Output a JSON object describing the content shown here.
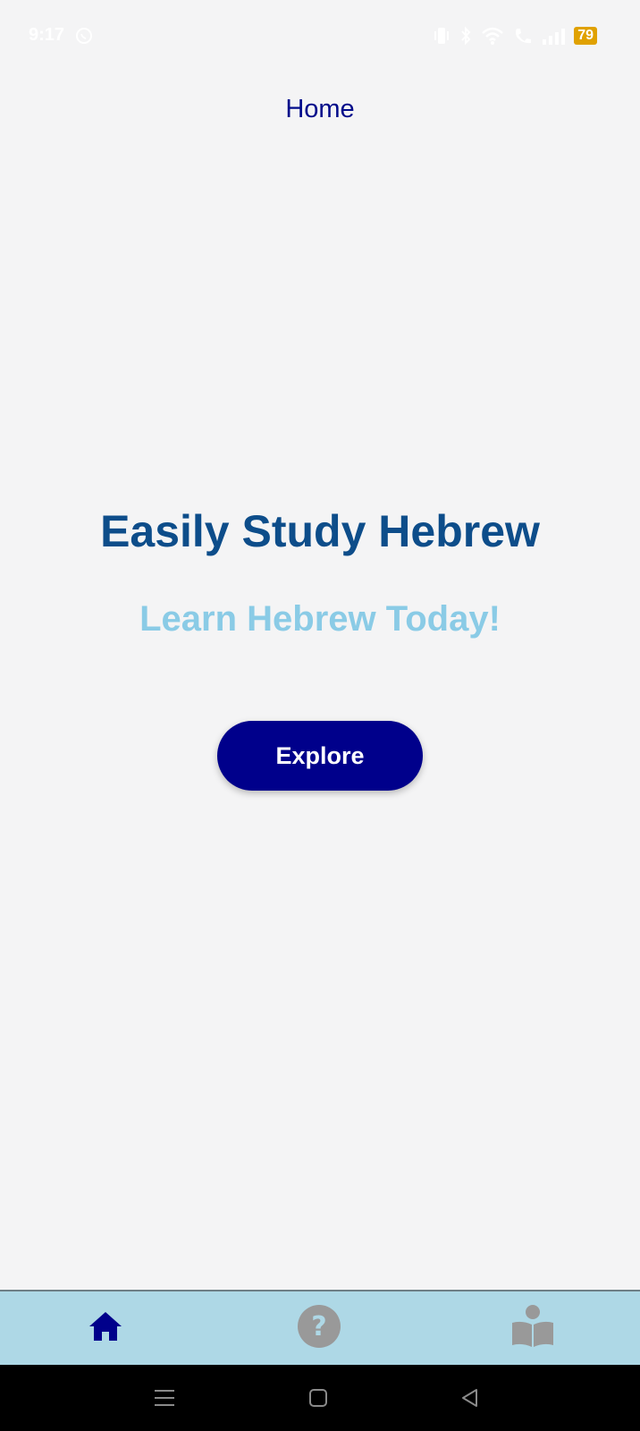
{
  "status_bar": {
    "time": "9:17",
    "battery": "79",
    "icons": [
      "whatsapp-icon",
      "vibrate-icon",
      "bluetooth-icon",
      "wifi-icon",
      "call-icon",
      "signal-icon"
    ]
  },
  "header": {
    "title": "Home"
  },
  "hero": {
    "title": "Easily Study Hebrew",
    "subtitle": "Learn Hebrew Today!",
    "explore_label": "Explore"
  },
  "tab_bar": {
    "tabs": [
      {
        "icon": "home-icon",
        "active": true
      },
      {
        "icon": "help-icon",
        "active": false
      },
      {
        "icon": "reader-icon",
        "active": false
      }
    ]
  },
  "colors": {
    "background": "#f4f4f5",
    "accent": "#00008b",
    "title": "#0d4d8a",
    "subtitle": "#8acbe6",
    "tab_bar": "#aed8e6",
    "inactive_icon": "#999999"
  },
  "system_nav": {
    "icons": [
      "menu-icon",
      "home-square-icon",
      "back-icon"
    ]
  }
}
